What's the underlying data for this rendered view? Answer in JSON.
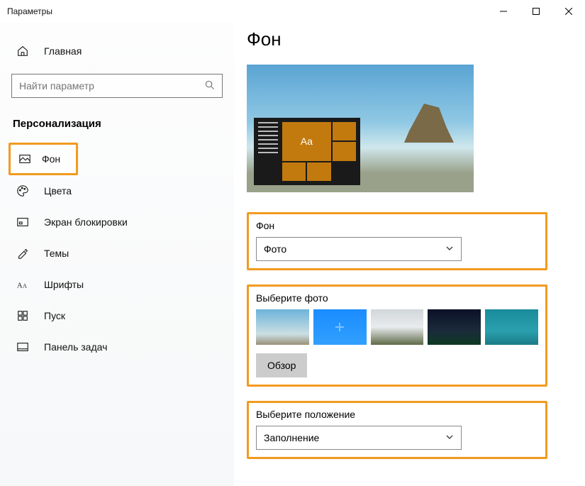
{
  "window": {
    "title": "Параметры"
  },
  "sidebar": {
    "home": "Главная",
    "search_placeholder": "Найти параметр",
    "section": "Персонализация",
    "items": [
      {
        "label": "Фон"
      },
      {
        "label": "Цвета"
      },
      {
        "label": "Экран блокировки"
      },
      {
        "label": "Темы"
      },
      {
        "label": "Шрифты"
      },
      {
        "label": "Пуск"
      },
      {
        "label": "Панель задач"
      }
    ]
  },
  "main": {
    "title": "Фон",
    "preview_tile_text": "Aa",
    "bg_section": {
      "label": "Фон",
      "value": "Фото"
    },
    "photo_section": {
      "label": "Выберите фото",
      "browse": "Обзор"
    },
    "position_section": {
      "label": "Выберите положение",
      "value": "Заполнение"
    }
  }
}
